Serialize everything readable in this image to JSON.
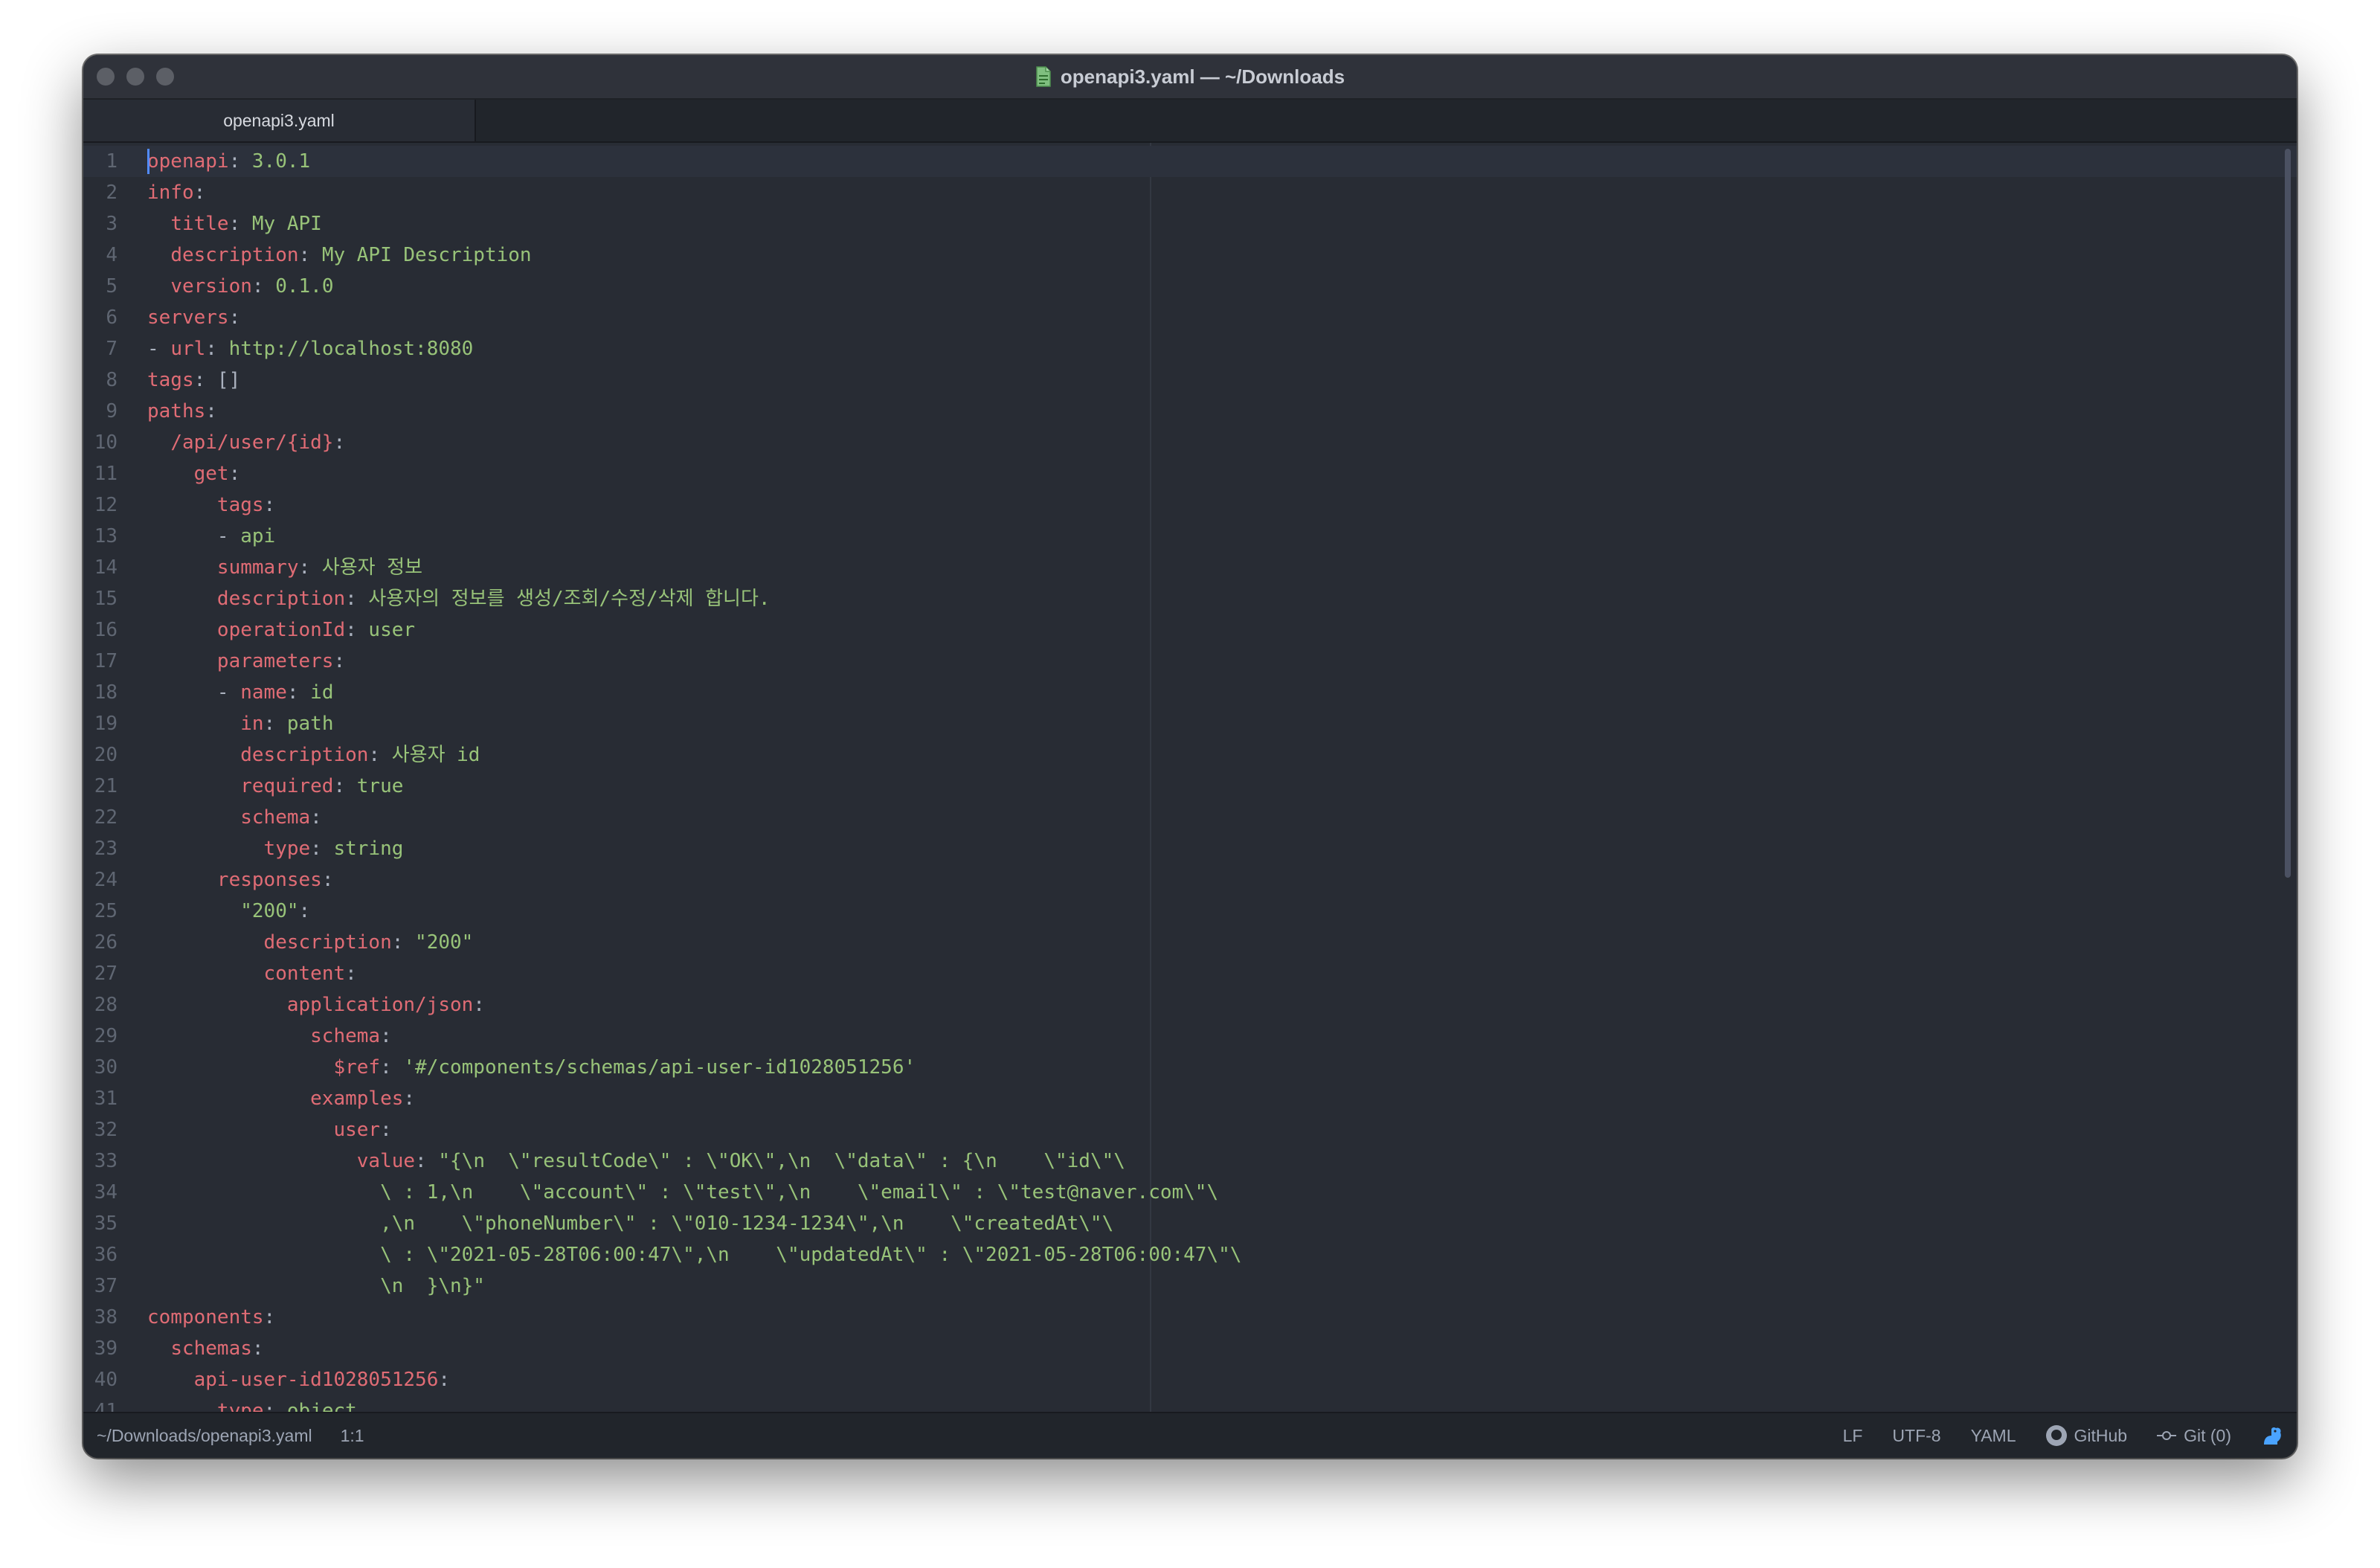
{
  "window": {
    "title": "openapi3.yaml — ~/Downloads"
  },
  "tabs": [
    {
      "label": "openapi3.yaml",
      "active": true
    }
  ],
  "editor": {
    "lines": [
      {
        "n": "1",
        "parts": [
          {
            "t": "openapi",
            "c": "k"
          },
          {
            "t": ": ",
            "c": "p"
          },
          {
            "t": "3.0.1",
            "c": "s"
          }
        ]
      },
      {
        "n": "2",
        "parts": [
          {
            "t": "info",
            "c": "k"
          },
          {
            "t": ":",
            "c": "p"
          }
        ]
      },
      {
        "n": "3",
        "parts": [
          {
            "t": "  ",
            "c": "p"
          },
          {
            "t": "title",
            "c": "k"
          },
          {
            "t": ": ",
            "c": "p"
          },
          {
            "t": "My API",
            "c": "s"
          }
        ]
      },
      {
        "n": "4",
        "parts": [
          {
            "t": "  ",
            "c": "p"
          },
          {
            "t": "description",
            "c": "k"
          },
          {
            "t": ": ",
            "c": "p"
          },
          {
            "t": "My API Description",
            "c": "s"
          }
        ]
      },
      {
        "n": "5",
        "parts": [
          {
            "t": "  ",
            "c": "p"
          },
          {
            "t": "version",
            "c": "k"
          },
          {
            "t": ": ",
            "c": "p"
          },
          {
            "t": "0.1.0",
            "c": "s"
          }
        ]
      },
      {
        "n": "6",
        "parts": [
          {
            "t": "servers",
            "c": "k"
          },
          {
            "t": ":",
            "c": "p"
          }
        ]
      },
      {
        "n": "7",
        "parts": [
          {
            "t": "- ",
            "c": "p"
          },
          {
            "t": "url",
            "c": "k"
          },
          {
            "t": ": ",
            "c": "p"
          },
          {
            "t": "http://localhost:8080",
            "c": "s"
          }
        ]
      },
      {
        "n": "8",
        "parts": [
          {
            "t": "tags",
            "c": "k"
          },
          {
            "t": ": []",
            "c": "p"
          }
        ]
      },
      {
        "n": "9",
        "parts": [
          {
            "t": "paths",
            "c": "k"
          },
          {
            "t": ":",
            "c": "p"
          }
        ]
      },
      {
        "n": "10",
        "parts": [
          {
            "t": "  ",
            "c": "p"
          },
          {
            "t": "/api/user/{id}",
            "c": "k"
          },
          {
            "t": ":",
            "c": "p"
          }
        ]
      },
      {
        "n": "11",
        "parts": [
          {
            "t": "    ",
            "c": "p"
          },
          {
            "t": "get",
            "c": "k"
          },
          {
            "t": ":",
            "c": "p"
          }
        ]
      },
      {
        "n": "12",
        "parts": [
          {
            "t": "      ",
            "c": "p"
          },
          {
            "t": "tags",
            "c": "k"
          },
          {
            "t": ":",
            "c": "p"
          }
        ]
      },
      {
        "n": "13",
        "parts": [
          {
            "t": "      - ",
            "c": "p"
          },
          {
            "t": "api",
            "c": "s"
          }
        ]
      },
      {
        "n": "14",
        "parts": [
          {
            "t": "      ",
            "c": "p"
          },
          {
            "t": "summary",
            "c": "k"
          },
          {
            "t": ": ",
            "c": "p"
          },
          {
            "t": "사용자 정보",
            "c": "s"
          }
        ]
      },
      {
        "n": "15",
        "parts": [
          {
            "t": "      ",
            "c": "p"
          },
          {
            "t": "description",
            "c": "k"
          },
          {
            "t": ": ",
            "c": "p"
          },
          {
            "t": "사용자의 정보를 생성/조회/수정/삭제 합니다.",
            "c": "s"
          }
        ]
      },
      {
        "n": "16",
        "parts": [
          {
            "t": "      ",
            "c": "p"
          },
          {
            "t": "operationId",
            "c": "k"
          },
          {
            "t": ": ",
            "c": "p"
          },
          {
            "t": "user",
            "c": "s"
          }
        ]
      },
      {
        "n": "17",
        "parts": [
          {
            "t": "      ",
            "c": "p"
          },
          {
            "t": "parameters",
            "c": "k"
          },
          {
            "t": ":",
            "c": "p"
          }
        ]
      },
      {
        "n": "18",
        "parts": [
          {
            "t": "      - ",
            "c": "p"
          },
          {
            "t": "name",
            "c": "k"
          },
          {
            "t": ": ",
            "c": "p"
          },
          {
            "t": "id",
            "c": "s"
          }
        ]
      },
      {
        "n": "19",
        "parts": [
          {
            "t": "        ",
            "c": "p"
          },
          {
            "t": "in",
            "c": "k"
          },
          {
            "t": ": ",
            "c": "p"
          },
          {
            "t": "path",
            "c": "s"
          }
        ]
      },
      {
        "n": "20",
        "parts": [
          {
            "t": "        ",
            "c": "p"
          },
          {
            "t": "description",
            "c": "k"
          },
          {
            "t": ": ",
            "c": "p"
          },
          {
            "t": "사용자 id",
            "c": "s"
          }
        ]
      },
      {
        "n": "21",
        "parts": [
          {
            "t": "        ",
            "c": "p"
          },
          {
            "t": "required",
            "c": "k"
          },
          {
            "t": ": ",
            "c": "p"
          },
          {
            "t": "true",
            "c": "s"
          }
        ]
      },
      {
        "n": "22",
        "parts": [
          {
            "t": "        ",
            "c": "p"
          },
          {
            "t": "schema",
            "c": "k"
          },
          {
            "t": ":",
            "c": "p"
          }
        ]
      },
      {
        "n": "23",
        "parts": [
          {
            "t": "          ",
            "c": "p"
          },
          {
            "t": "type",
            "c": "k"
          },
          {
            "t": ": ",
            "c": "p"
          },
          {
            "t": "string",
            "c": "s"
          }
        ]
      },
      {
        "n": "24",
        "parts": [
          {
            "t": "      ",
            "c": "p"
          },
          {
            "t": "responses",
            "c": "k"
          },
          {
            "t": ":",
            "c": "p"
          }
        ]
      },
      {
        "n": "25",
        "parts": [
          {
            "t": "        ",
            "c": "p"
          },
          {
            "t": "\"200\"",
            "c": "s"
          },
          {
            "t": ":",
            "c": "p"
          }
        ]
      },
      {
        "n": "26",
        "parts": [
          {
            "t": "          ",
            "c": "p"
          },
          {
            "t": "description",
            "c": "k"
          },
          {
            "t": ": ",
            "c": "p"
          },
          {
            "t": "\"200\"",
            "c": "s"
          }
        ]
      },
      {
        "n": "27",
        "parts": [
          {
            "t": "          ",
            "c": "p"
          },
          {
            "t": "content",
            "c": "k"
          },
          {
            "t": ":",
            "c": "p"
          }
        ]
      },
      {
        "n": "28",
        "parts": [
          {
            "t": "            ",
            "c": "p"
          },
          {
            "t": "application/json",
            "c": "k"
          },
          {
            "t": ":",
            "c": "p"
          }
        ]
      },
      {
        "n": "29",
        "parts": [
          {
            "t": "              ",
            "c": "p"
          },
          {
            "t": "schema",
            "c": "k"
          },
          {
            "t": ":",
            "c": "p"
          }
        ]
      },
      {
        "n": "30",
        "parts": [
          {
            "t": "                ",
            "c": "p"
          },
          {
            "t": "$ref",
            "c": "k"
          },
          {
            "t": ": ",
            "c": "p"
          },
          {
            "t": "'#/components/schemas/api-user-id1028051256'",
            "c": "s"
          }
        ]
      },
      {
        "n": "31",
        "parts": [
          {
            "t": "              ",
            "c": "p"
          },
          {
            "t": "examples",
            "c": "k"
          },
          {
            "t": ":",
            "c": "p"
          }
        ]
      },
      {
        "n": "32",
        "parts": [
          {
            "t": "                ",
            "c": "p"
          },
          {
            "t": "user",
            "c": "k"
          },
          {
            "t": ":",
            "c": "p"
          }
        ]
      },
      {
        "n": "33",
        "parts": [
          {
            "t": "                  ",
            "c": "p"
          },
          {
            "t": "value",
            "c": "k"
          },
          {
            "t": ": ",
            "c": "p"
          },
          {
            "t": "\"{\\n  \\\"resultCode\\\" : \\\"OK\\\",\\n  \\\"data\\\" : {\\n    \\\"id\\\"\\",
            "c": "s"
          }
        ]
      },
      {
        "n": "34",
        "parts": [
          {
            "t": "                    ",
            "c": "p"
          },
          {
            "t": "\\ : 1,\\n    \\\"account\\\" : \\\"test\\\",\\n    \\\"email\\\" : \\\"test@naver.com\\\"\\",
            "c": "s"
          }
        ]
      },
      {
        "n": "35",
        "parts": [
          {
            "t": "                    ",
            "c": "p"
          },
          {
            "t": ",\\n    \\\"phoneNumber\\\" : \\\"010-1234-1234\\\",\\n    \\\"createdAt\\\"\\",
            "c": "s"
          }
        ]
      },
      {
        "n": "36",
        "parts": [
          {
            "t": "                    ",
            "c": "p"
          },
          {
            "t": "\\ : \\\"2021-05-28T06:00:47\\\",\\n    \\\"updatedAt\\\" : \\\"2021-05-28T06:00:47\\\"\\",
            "c": "s"
          }
        ]
      },
      {
        "n": "37",
        "parts": [
          {
            "t": "                    ",
            "c": "p"
          },
          {
            "t": "\\n  }\\n}\"",
            "c": "s"
          }
        ]
      },
      {
        "n": "38",
        "parts": [
          {
            "t": "components",
            "c": "k"
          },
          {
            "t": ":",
            "c": "p"
          }
        ]
      },
      {
        "n": "39",
        "parts": [
          {
            "t": "  ",
            "c": "p"
          },
          {
            "t": "schemas",
            "c": "k"
          },
          {
            "t": ":",
            "c": "p"
          }
        ]
      },
      {
        "n": "40",
        "parts": [
          {
            "t": "    ",
            "c": "p"
          },
          {
            "t": "api-user-id1028051256",
            "c": "k"
          },
          {
            "t": ":",
            "c": "p"
          }
        ]
      },
      {
        "n": "41",
        "parts": [
          {
            "t": "      ",
            "c": "p"
          },
          {
            "t": "type",
            "c": "k"
          },
          {
            "t": ": ",
            "c": "p"
          },
          {
            "t": "object",
            "c": "s"
          }
        ]
      }
    ]
  },
  "statusbar": {
    "path": "~/Downloads/openapi3.yaml",
    "cursor": "1:1",
    "line_ending": "LF",
    "encoding": "UTF-8",
    "grammar": "YAML",
    "github": "GitHub",
    "git": "Git (0)"
  },
  "colors": {
    "key": "#e06c75",
    "string": "#98c379",
    "punct": "#abb2bf",
    "background": "#282c34"
  }
}
